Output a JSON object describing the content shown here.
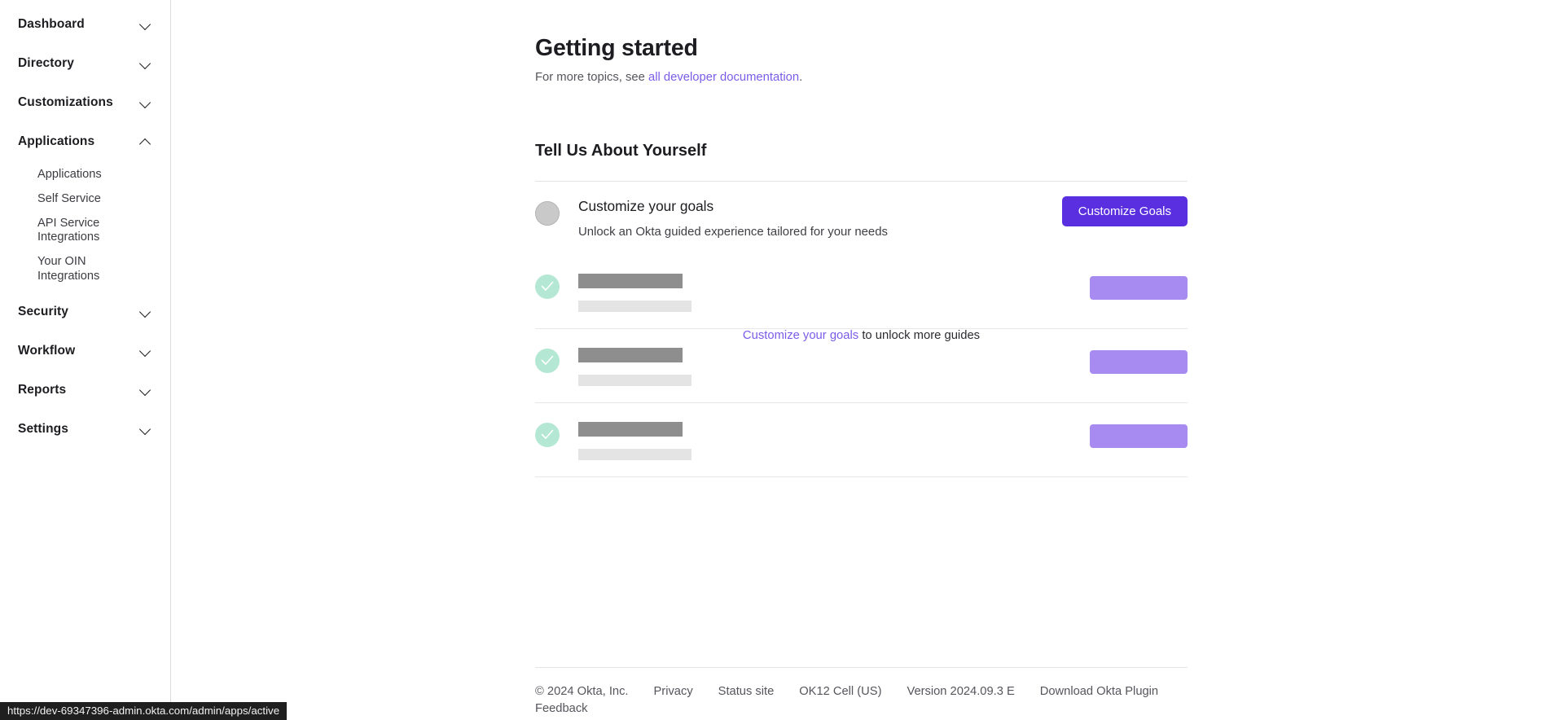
{
  "sidebar": {
    "groups": [
      {
        "label": "Dashboard",
        "icon": "chevron-down-icon",
        "expanded": false,
        "items": []
      },
      {
        "label": "Directory",
        "icon": "chevron-down-icon",
        "expanded": false,
        "items": []
      },
      {
        "label": "Customizations",
        "icon": "chevron-down-icon",
        "expanded": false,
        "items": []
      },
      {
        "label": "Applications",
        "icon": "chevron-up-icon",
        "expanded": true,
        "items": [
          "Applications",
          "Self Service",
          "API Service Integrations",
          "Your OIN Integrations"
        ]
      },
      {
        "label": "Security",
        "icon": "chevron-down-icon",
        "expanded": false,
        "items": []
      },
      {
        "label": "Workflow",
        "icon": "chevron-down-icon",
        "expanded": false,
        "items": []
      },
      {
        "label": "Reports",
        "icon": "chevron-down-icon",
        "expanded": false,
        "items": []
      },
      {
        "label": "Settings",
        "icon": "chevron-down-icon",
        "expanded": false,
        "items": []
      }
    ]
  },
  "page": {
    "title": "Getting started",
    "subtitle_prefix": "For more topics, see ",
    "subtitle_link": "all developer documentation",
    "subtitle_suffix": ".",
    "section_title": "Tell Us About Yourself"
  },
  "goal_row": {
    "bullet_icon": "empty-circle-icon",
    "title": "Customize your goals",
    "description": "Unlock an Okta guided experience tailored for your needs",
    "button_label": "Customize Goals"
  },
  "locked_rows": [
    {
      "bullet_icon": "check-circle-icon",
      "title_placeholder": "",
      "desc_placeholder": "",
      "button_placeholder": ""
    },
    {
      "bullet_icon": "check-circle-icon",
      "title_placeholder": "",
      "desc_placeholder": "",
      "button_placeholder": ""
    },
    {
      "bullet_icon": "check-circle-icon",
      "title_placeholder": "",
      "desc_placeholder": "",
      "button_placeholder": ""
    }
  ],
  "unlock_note": {
    "link_text": "Customize your goals",
    "rest_text": " to unlock more guides"
  },
  "footer": {
    "copyright": "© 2024 Okta, Inc.",
    "links": [
      "Privacy",
      "Status site",
      "OK12 Cell (US)",
      "Version 2024.09.3 E",
      "Download Okta Plugin",
      "Feedback"
    ]
  },
  "statusbar": {
    "url": "https://dev-69347396-admin.okta.com/admin/apps/active"
  },
  "colors": {
    "accent_purple": "#5a2fe0",
    "link_purple": "#7b5ce8",
    "skeleton_button": "#a78bf0",
    "skeleton_title": "#8e8e8e",
    "skeleton_desc": "#e4e4e4",
    "check_circle": "#b4e8d4",
    "empty_circle": "#c9c9c9"
  }
}
